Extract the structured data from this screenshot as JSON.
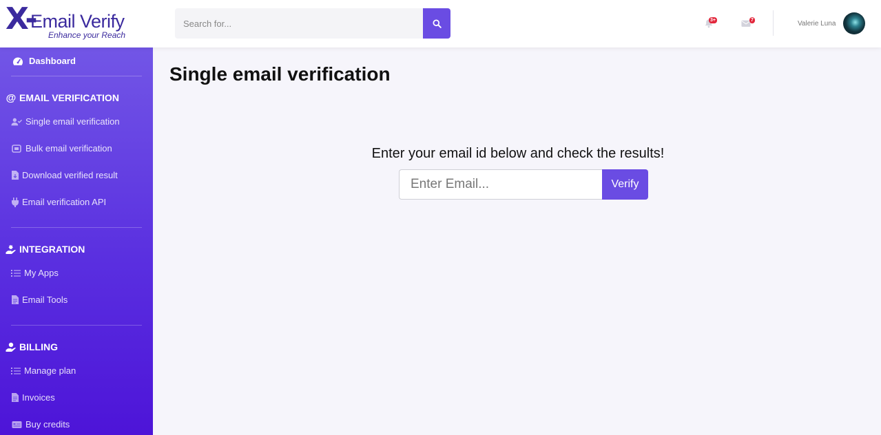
{
  "logo": {
    "mark": "X-",
    "name": "Email Verify",
    "tagline": "Enhance your Reach"
  },
  "search": {
    "placeholder": "Search for...",
    "icon": "search-icon"
  },
  "notifications": {
    "alerts_badge": "3+",
    "messages_badge": "7"
  },
  "user": {
    "name": "Valerie Luna"
  },
  "sidebar": {
    "dashboard": "Dashboard",
    "sections": [
      {
        "title": "EMAIL VERIFICATION",
        "icon": "at-icon",
        "items": [
          {
            "label": "Single email verification",
            "icon": "user-check-icon"
          },
          {
            "label": "Bulk email verification",
            "icon": "bulk-icon"
          },
          {
            "label": "Download verified result",
            "icon": "file-download-icon"
          },
          {
            "label": "Email verification API",
            "icon": "plug-icon"
          }
        ]
      },
      {
        "title": "INTEGRATION",
        "icon": "hand-holding-icon",
        "items": [
          {
            "label": "My Apps",
            "icon": "list-icon"
          },
          {
            "label": "Email Tools",
            "icon": "file-icon"
          }
        ]
      },
      {
        "title": "BILLING",
        "icon": "hand-holding-icon",
        "items": [
          {
            "label": "Manage plan",
            "icon": "list-icon"
          },
          {
            "label": "Invoices",
            "icon": "file-icon"
          },
          {
            "label": "Buy credits",
            "icon": "credit-card-icon"
          }
        ]
      }
    ]
  },
  "main": {
    "title": "Single email verification",
    "prompt": "Enter your email id below and check the results!",
    "email_placeholder": "Enter Email...",
    "verify_label": "Verify"
  },
  "colors": {
    "accent": "#6a4ce3",
    "sidebar_top": "#7256e6",
    "sidebar_bottom": "#4d14d8",
    "badge": "#e2263b",
    "logo": "#3b2a9e"
  }
}
